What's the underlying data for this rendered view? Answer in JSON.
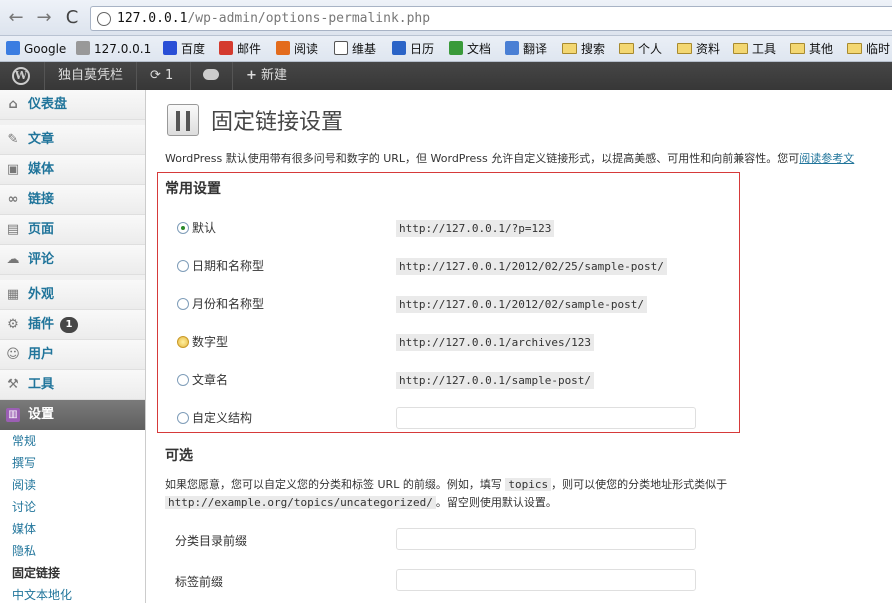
{
  "browser": {
    "url_host": "127.0.0.1",
    "url_path": "/wp-admin/options-permalink.php",
    "bookmarks": [
      {
        "label": "Google",
        "icon": "google-icon",
        "kind": "site"
      },
      {
        "label": "127.0.0.1",
        "icon": "globe-icon",
        "kind": "site"
      },
      {
        "label": "百度",
        "icon": "baidu-icon",
        "kind": "site"
      },
      {
        "label": "邮件",
        "icon": "gmail-icon",
        "kind": "site"
      },
      {
        "label": "阅读",
        "icon": "reader-icon",
        "kind": "site"
      },
      {
        "label": "维基",
        "icon": "wikipedia-icon",
        "kind": "site"
      },
      {
        "label": "日历",
        "icon": "calendar-icon",
        "kind": "site"
      },
      {
        "label": "文档",
        "icon": "docs-icon",
        "kind": "site"
      },
      {
        "label": "翻译",
        "icon": "translate-icon",
        "kind": "site"
      },
      {
        "label": "搜索",
        "icon": "folder-icon",
        "kind": "folder"
      },
      {
        "label": "个人",
        "icon": "folder-icon",
        "kind": "folder"
      },
      {
        "label": "资料",
        "icon": "folder-icon",
        "kind": "folder"
      },
      {
        "label": "工具",
        "icon": "folder-icon",
        "kind": "folder"
      },
      {
        "label": "其他",
        "icon": "folder-icon",
        "kind": "folder"
      },
      {
        "label": "临时",
        "icon": "folder-icon",
        "kind": "folder"
      }
    ]
  },
  "adminbar": {
    "site_name": "独自莫凭栏",
    "updates_count": "1",
    "new_label": "新建"
  },
  "sidebar": {
    "items": [
      {
        "label": "仪表盘",
        "icon": "dashboard-icon",
        "glyph": "⌂"
      },
      {
        "label": "文章",
        "icon": "pin-icon",
        "glyph": "✎"
      },
      {
        "label": "媒体",
        "icon": "media-icon",
        "glyph": "▣"
      },
      {
        "label": "链接",
        "icon": "link-icon",
        "glyph": "∞"
      },
      {
        "label": "页面",
        "icon": "page-icon",
        "glyph": "▤"
      },
      {
        "label": "评论",
        "icon": "comment-icon",
        "glyph": "☁"
      },
      {
        "label": "外观",
        "icon": "appearance-icon",
        "glyph": "▦"
      },
      {
        "label": "插件",
        "icon": "plugin-icon",
        "glyph": "⚙",
        "badge": "1"
      },
      {
        "label": "用户",
        "icon": "users-icon",
        "glyph": "☺"
      },
      {
        "label": "工具",
        "icon": "tools-icon",
        "glyph": "⚒"
      },
      {
        "label": "设置",
        "icon": "settings-icon",
        "glyph": "▥",
        "current": true
      }
    ],
    "submenu": [
      "常规",
      "撰写",
      "阅读",
      "讨论",
      "媒体",
      "隐私",
      "固定链接",
      "中文本地化"
    ],
    "submenu_current": "固定链接"
  },
  "main": {
    "title": "固定链接设置",
    "intro_text": "WordPress 默认使用带有很多问号和数字的 URL，但 WordPress 允许自定义链接形式，以提高美感、可用性和向前兼容性。您可",
    "intro_link": "阅读参考文",
    "common_heading": "常用设置",
    "options": [
      {
        "label": "默认",
        "example": "http://127.0.0.1/?p=123",
        "checked": true
      },
      {
        "label": "日期和名称型",
        "example": "http://127.0.0.1/2012/02/25/sample-post/"
      },
      {
        "label": "月份和名称型",
        "example": "http://127.0.0.1/2012/02/sample-post/"
      },
      {
        "label": "数字型",
        "example": "http://127.0.0.1/archives/123",
        "hover": true
      },
      {
        "label": "文章名",
        "example": "http://127.0.0.1/sample-post/"
      },
      {
        "label": "自定义结构",
        "example": ""
      }
    ],
    "optional_heading": "可选",
    "optional_desc_1": "如果您愿意，您可以自定义您的分类和标签 URL 的前缀。例如，填写",
    "optional_code_1": "topics",
    "optional_desc_2": "，则可以使您的分类地址形式类似于",
    "optional_code_2": "http://example.org/topics/uncategorized/",
    "optional_desc_3": "。留空则使用默认设置。",
    "category_base_label": "分类目录前缀",
    "tag_base_label": "标签前缀"
  }
}
